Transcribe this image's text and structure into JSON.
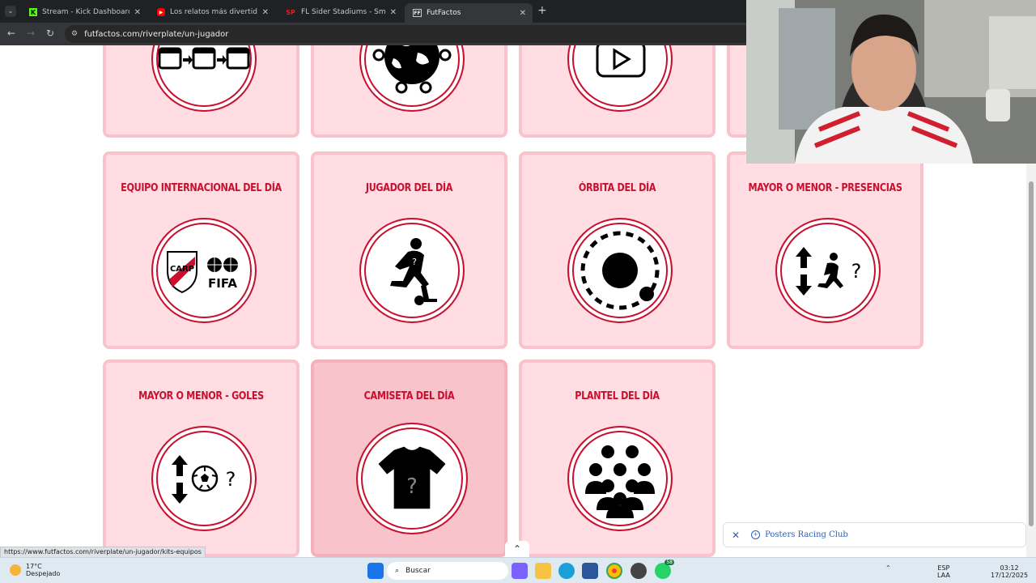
{
  "browser": {
    "tabs": [
      {
        "title": "Stream - Kick Dashboard",
        "favicon": "K",
        "color": "#53fc18"
      },
      {
        "title": "Los relatos más divertidos de M",
        "favicon": "▶",
        "color": "#ff0000"
      },
      {
        "title": "FL Sider Stadiums - SmokePatch",
        "favicon": "SP",
        "color": "#e02020"
      },
      {
        "title": "FutFactos",
        "favicon": "FF",
        "color": "#c4c7c5"
      }
    ],
    "url": "futfactos.com/riverplate/un-jugador"
  },
  "cards": {
    "row1": [
      "",
      "",
      ""
    ],
    "row2": [
      "EQUIPO INTERNACIONAL DEL DÍA",
      "JUGADOR DEL DÍA",
      "ÓRBITA DEL DÍA",
      "MAYOR O MENOR - PRESENCIAS"
    ],
    "row3": [
      "MAYOR O MENOR - GOLES",
      "CAMISETA DEL DÍA",
      "PLANTEL DEL DÍA"
    ]
  },
  "icons": {
    "calendar": "calendars-icon",
    "world": "world-network-icon",
    "video": "play-video-icon",
    "intl": "river-fifa-icon",
    "player": "mystery-player-icon",
    "orbit": "orbit-icon",
    "presences": "higher-lower-player-icon",
    "goals": "higher-lower-ball-icon",
    "shirt": "mystery-shirt-icon",
    "squad": "squad-icon"
  },
  "fifa_text": "FIFA",
  "question_mark": "?",
  "status_url": "https://www.futfactos.com/riverplate/un-jugador/kits-equipos",
  "notification": {
    "text": "Posters Racing Club"
  },
  "taskbar": {
    "temp": "17°C",
    "weather": "Despejado",
    "search": "Buscar",
    "lang1": "ESP",
    "lang2": "LAA",
    "time": "03:12",
    "date": "17/12/2025",
    "badge": "58"
  },
  "colors": {
    "accent": "#c8102e",
    "card": "#ffdde2",
    "card_border": "#f8c3cb"
  }
}
